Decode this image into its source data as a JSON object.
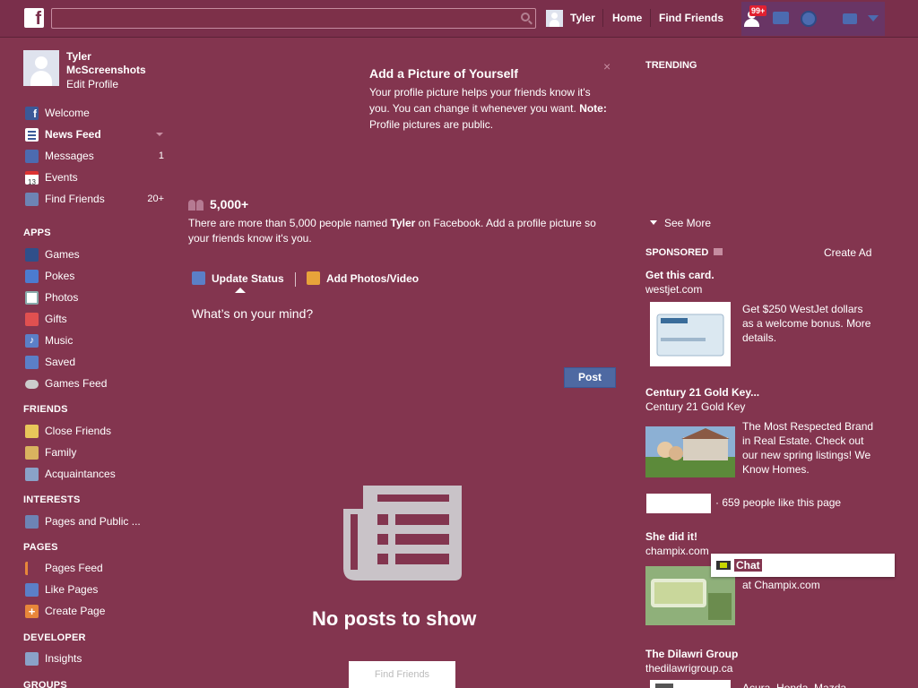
{
  "topbar": {
    "logo": "f",
    "search_placeholder": "",
    "user_name": "Tyler",
    "home": "Home",
    "find_friends": "Find Friends",
    "notif_badge": "99+"
  },
  "profile": {
    "name": "Tyler McScreenshots",
    "edit": "Edit Profile"
  },
  "left_nav": {
    "main": [
      {
        "label": "Welcome",
        "count": "",
        "icon": "facebook-icon"
      },
      {
        "label": "News Feed",
        "count": "",
        "icon": "news-feed-icon"
      },
      {
        "label": "Messages",
        "count": "1",
        "icon": "messages-icon"
      },
      {
        "label": "Events",
        "count": "",
        "icon": "calendar-icon",
        "icon_text": "13"
      },
      {
        "label": "Find Friends",
        "count": "20+",
        "icon": "find-friends-icon"
      }
    ],
    "apps_header": "APPS",
    "apps": [
      {
        "label": "Games",
        "icon": "games-icon"
      },
      {
        "label": "Pokes",
        "icon": "pokes-icon"
      },
      {
        "label": "Photos",
        "icon": "photos-icon"
      },
      {
        "label": "Gifts",
        "icon": "gift-icon"
      },
      {
        "label": "Music",
        "icon": "music-icon"
      },
      {
        "label": "Saved",
        "icon": "bookmark-icon"
      },
      {
        "label": "Games Feed",
        "icon": "gamepad-icon"
      }
    ],
    "friends_header": "FRIENDS",
    "friends": [
      {
        "label": "Close Friends",
        "icon": "star-friends-icon"
      },
      {
        "label": "Family",
        "icon": "family-icon"
      },
      {
        "label": "Acquaintances",
        "icon": "acquaintances-icon"
      }
    ],
    "interests_header": "INTERESTS",
    "interests": [
      {
        "label": "Pages and Public ...",
        "icon": "rss-icon"
      }
    ],
    "pages_header": "PAGES",
    "pages": [
      {
        "label": "Pages Feed",
        "icon": "flag-icon"
      },
      {
        "label": "Like Pages",
        "icon": "thumbs-up-icon"
      },
      {
        "label": "Create Page",
        "icon": "plus-icon"
      }
    ],
    "developer_header": "DEVELOPER",
    "developer": [
      {
        "label": "Insights",
        "icon": "chart-icon"
      }
    ],
    "groups_header": "GROUPS"
  },
  "profile_prompt": {
    "title": "Add a Picture of Yourself",
    "body": "Your profile picture helps your friends know it's you. You can change it whenever you want.",
    "note_label": "Note:",
    "note_text": "Profile pictures are public.",
    "close": "×",
    "count": "5,000+",
    "count_desc_1": "There are more than 5,000 people named",
    "count_name": "Tyler",
    "count_desc_2": "on Facebook. Add a profile picture so your friends know it's you."
  },
  "composer": {
    "tab_status": "Update Status",
    "tab_photos": "Add Photos/Video",
    "placeholder": "What’s on your mind?",
    "post": "Post"
  },
  "feed": {
    "empty": "No posts to show",
    "find_friends_btn": "Find Friends"
  },
  "right": {
    "trending": "TRENDING",
    "see_more": "See More",
    "sponsored": "SPONSORED",
    "create_ad": "Create Ad",
    "ads": [
      {
        "title": "Get this card.",
        "url": "westjet.com",
        "desc": "Get $250 WestJet dollars as a welcome bonus. More details."
      },
      {
        "title": "Century 21 Gold Key...",
        "url": "Century 21 Gold Key",
        "desc": "The Most Respected Brand in Real Estate. Check out our new spring listings! We Know Homes."
      },
      {
        "title": "She did it!",
        "url": "champix.com",
        "desc": "at Champix.com"
      },
      {
        "title": "The Dilawri Group",
        "url": "thedilawrigroup.ca",
        "desc": "Acura, Honda, Mazda,"
      }
    ],
    "like_text": "· 659 people like this page",
    "chat": "Chat"
  },
  "colors": {
    "background": "#83354f",
    "accent": "#4e69a2",
    "badge": "#e02030"
  }
}
